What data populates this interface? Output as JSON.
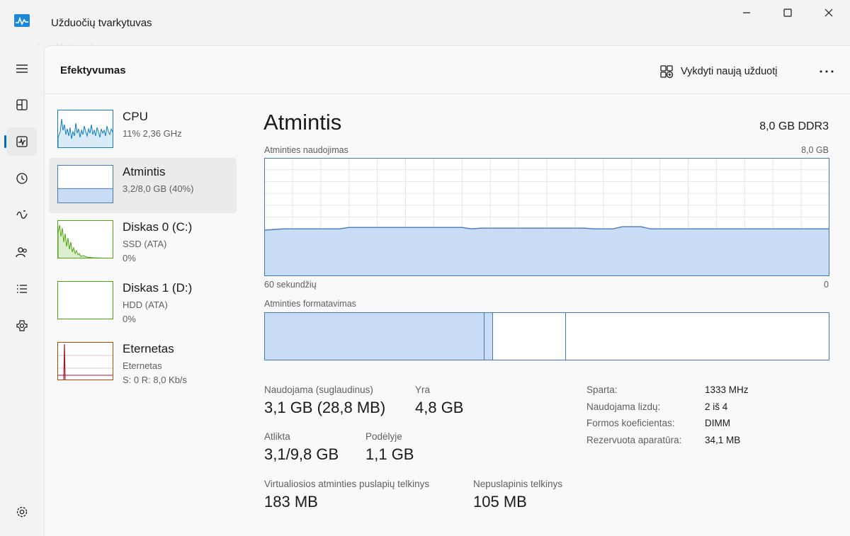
{
  "window": {
    "title": "Užduočių tvarkytuvas",
    "watermark": "skelbiu.lt",
    "controls": {
      "minimize": "minimize-icon",
      "maximize": "maximize-icon",
      "close": "close-icon"
    }
  },
  "nav": {
    "items": [
      {
        "icon": "hamburger-menu-icon"
      },
      {
        "icon": "processes-icon"
      },
      {
        "icon": "performance-icon",
        "active": true
      },
      {
        "icon": "app-history-icon"
      },
      {
        "icon": "startup-apps-icon"
      },
      {
        "icon": "users-icon"
      },
      {
        "icon": "details-icon"
      },
      {
        "icon": "services-icon"
      },
      {
        "icon": "settings-icon"
      }
    ]
  },
  "header": {
    "title": "Efektyvumas",
    "run_task_label": "Vykdyti naują užduotį",
    "more_icon": "more-icon"
  },
  "side": {
    "items": [
      {
        "name": "CPU",
        "sub1": "11% 2,36 GHz",
        "sub2": "",
        "color": "#117dbb"
      },
      {
        "name": "Atmintis",
        "sub1": "3,2/8,0 GB (40%)",
        "sub2": "",
        "color": "#4779b5",
        "selected": true,
        "fill_fraction": 0.4
      },
      {
        "name": "Diskas 0 (C:)",
        "sub1": "SSD (ATA)",
        "sub2": "0%",
        "color": "#4da60c"
      },
      {
        "name": "Diskas 1 (D:)",
        "sub1": "HDD (ATA)",
        "sub2": "0%",
        "color": "#4da60c"
      },
      {
        "name": "Eternetas",
        "sub1": "Eternetas",
        "sub2": "S: 0 R: 8,0 Kb/s",
        "color": "#a74f01"
      }
    ]
  },
  "memory": {
    "title": "Atmintis",
    "type": "8,0 GB DDR3",
    "usage_label": "Atminties naudojimas",
    "usage_max": "8,0 GB",
    "time_left": "60 sekundžių",
    "time_right": "0",
    "usage_fraction": 0.4,
    "composition_label": "Atminties formatavimas",
    "composition": {
      "in_use": 0.39,
      "modified": 0.015,
      "standby": 0.13,
      "free": 0.465
    },
    "stats": {
      "in_use_label": "Naudojama (suglaudinus)",
      "in_use_value": "3,1 GB (28,8 MB)",
      "available_label": "Yra",
      "available_value": "4,8 GB",
      "committed_label": "Atlikta",
      "committed_value": "3,1/9,8 GB",
      "cached_label": "Podėlyje",
      "cached_value": "1,1 GB",
      "paged_label": "Virtualiosios atminties puslapių telkinys",
      "paged_value": "183 MB",
      "nonpaged_label": "Nepuslapinis telkinys",
      "nonpaged_value": "105 MB"
    },
    "info": [
      {
        "label": "Sparta:",
        "value": "1333 MHz"
      },
      {
        "label": "Naudojama lizdų:",
        "value": "2 iš 4"
      },
      {
        "label": "Formos koeficientas:",
        "value": "DIMM"
      },
      {
        "label": "Rezervuota aparatūra:",
        "value": "34,1 MB"
      }
    ],
    "colors": {
      "accent": "#4779b5",
      "fill": "#c9dcf5",
      "grid": "#e6e6e6"
    }
  }
}
